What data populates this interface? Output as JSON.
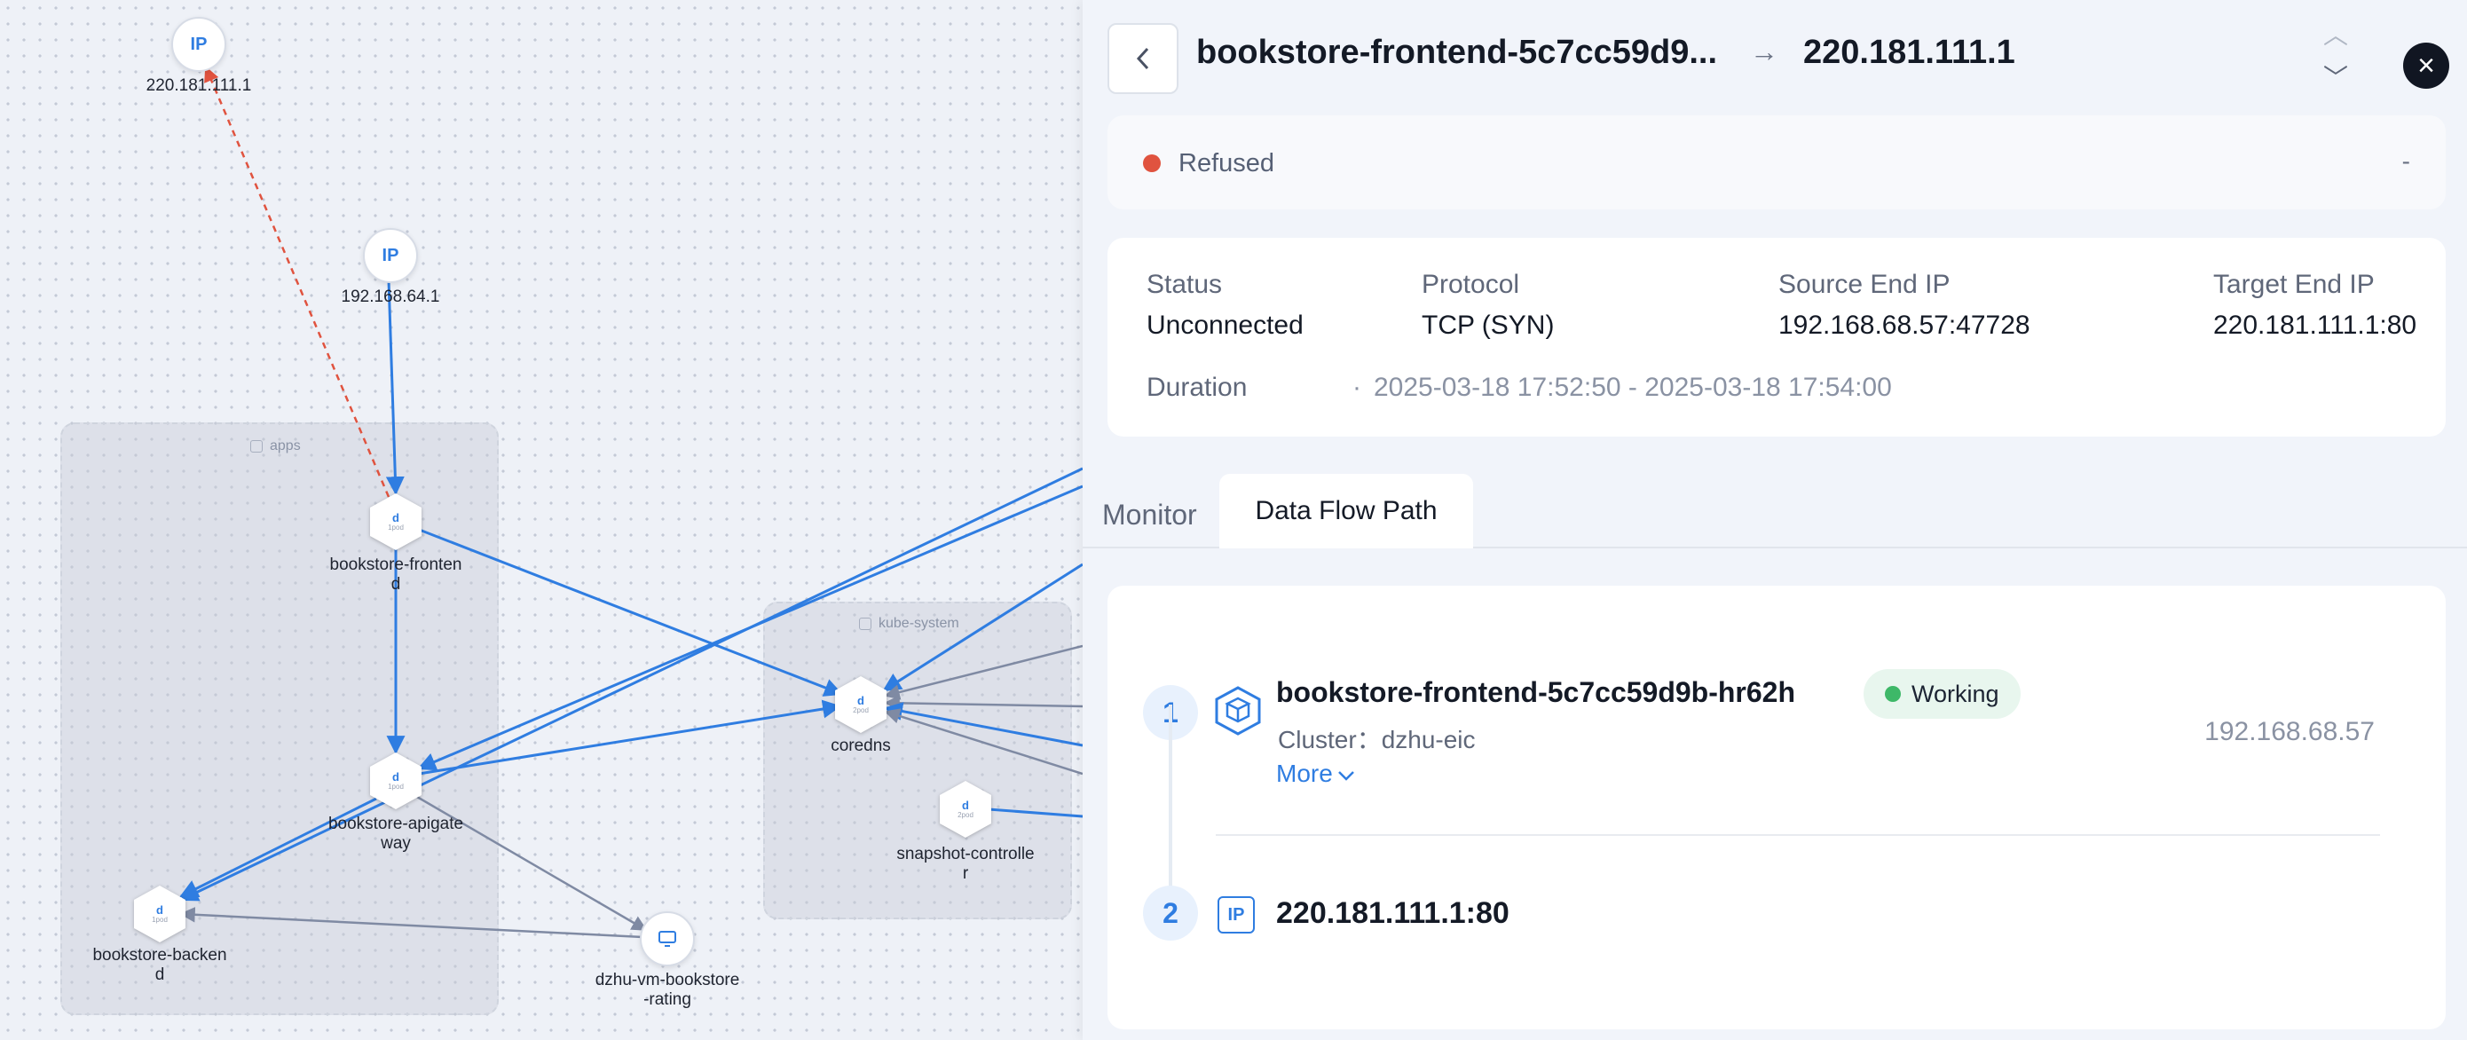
{
  "topology": {
    "groups": [
      {
        "id": "apps",
        "label": "apps"
      },
      {
        "id": "kube",
        "label": "kube-system"
      }
    ],
    "nodes": [
      {
        "id": "ip1",
        "kind": "ip",
        "icon": "IP",
        "label": "220.181.111.1"
      },
      {
        "id": "ip2",
        "kind": "ip",
        "icon": "IP",
        "label": "192.168.64.1"
      },
      {
        "id": "front",
        "kind": "deploy",
        "icon": "d",
        "pods": "1pod",
        "label": "bookstore-fronten\nd"
      },
      {
        "id": "gw",
        "kind": "deploy",
        "icon": "d",
        "pods": "1pod",
        "label": "bookstore-apigate\nway"
      },
      {
        "id": "back",
        "kind": "deploy",
        "icon": "d",
        "pods": "1pod",
        "label": "bookstore-backen\nd"
      },
      {
        "id": "dns",
        "kind": "deploy",
        "icon": "d",
        "pods": "2pod",
        "label": "coredns"
      },
      {
        "id": "snap",
        "kind": "deploy",
        "icon": "d",
        "pods": "2pod",
        "label": "snapshot-controlle\nr"
      },
      {
        "id": "vm",
        "kind": "vm",
        "icon": "monitor-icon",
        "label": "dzhu-vm-bookstore\n-rating"
      }
    ]
  },
  "header": {
    "back_icon": "chevron-left-icon",
    "source": "bookstore-frontend-5c7cc59d9...",
    "arrow": "→",
    "target": "220.181.111.1",
    "nav_up": "︿",
    "nav_down": "﹀",
    "close": "×"
  },
  "status_bar": {
    "status": "Refused",
    "status_color": "#e0533f",
    "extra": "-"
  },
  "info": {
    "status_label": "Status",
    "status_value": "Unconnected",
    "protocol_label": "Protocol",
    "protocol_value": "TCP (SYN)",
    "source_label": "Source End IP",
    "source_value": "192.168.68.57:47728",
    "target_label": "Target End IP",
    "target_value": "220.181.111.1:80",
    "duration_label": "Duration",
    "duration_value": "2025-03-18 17:52:50 - 2025-03-18 17:54:00"
  },
  "tabs": {
    "monitor": "Monitor",
    "data_flow": "Data Flow Path",
    "active": "data_flow"
  },
  "path": {
    "steps": [
      {
        "number": "1",
        "name": "bookstore-frontend-5c7cc59d9b-hr62h",
        "state": "Working",
        "state_color": "#3eb868",
        "cluster": "Cluster：dzhu-eic",
        "more": "More",
        "ip": "192.168.68.57"
      },
      {
        "number": "2",
        "icon": "IP",
        "target": "220.181.111.1:80"
      }
    ]
  },
  "colors": {
    "accent": "#2f7de1",
    "edge_gray": "#7f8aa3",
    "edge_refused": "#e0533f"
  }
}
